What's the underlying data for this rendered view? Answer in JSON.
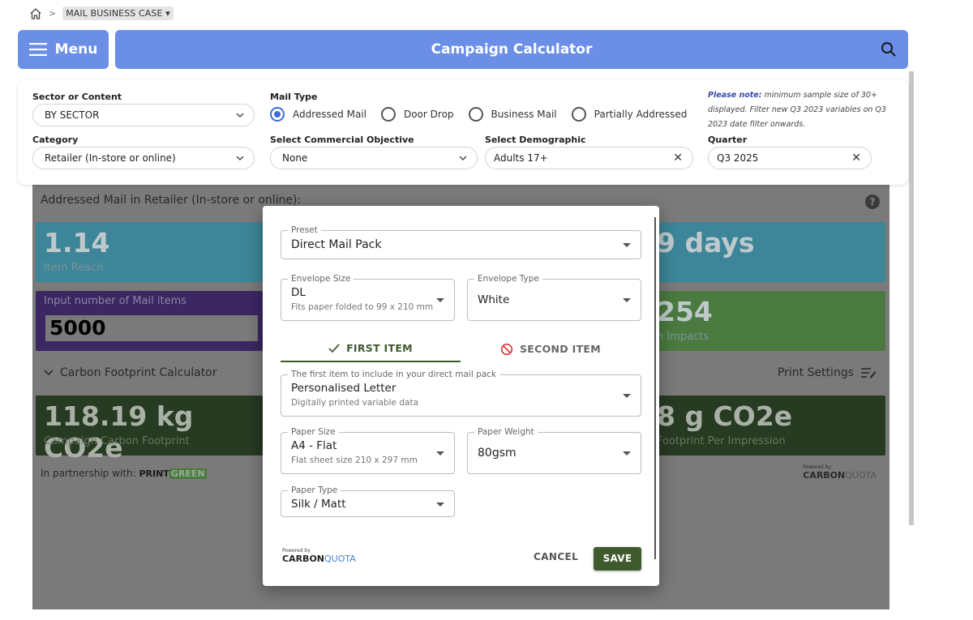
{
  "breadcrumb": {
    "current": "MAIL BUSINESS CASE"
  },
  "header": {
    "menu_label": "Menu",
    "title": "Campaign Calculator"
  },
  "filters": {
    "sector_label": "Sector or Content",
    "sector_value": "BY SECTOR",
    "category_label": "Category",
    "category_value": "Retailer (In-store or online)",
    "mail_type_label": "Mail Type",
    "mail_types": [
      "Addressed Mail",
      "Door Drop",
      "Business Mail",
      "Partially Addressed"
    ],
    "mail_type_selected": "Addressed Mail",
    "objective_label": "Select Commercial Objective",
    "objective_value": "None",
    "demographic_label": "Select Demographic",
    "demographic_value": "Adults 17+",
    "quarter_label": "Quarter",
    "quarter_value": "Q3 2025",
    "note_bold": "Please note:",
    "note_text": " minimum sample size of 30+ displayed. Filter new Q3 2023 variables on Q3 2023 date filter onwards."
  },
  "results": {
    "heading": "Addressed Mail in Retailer (In-store or online):",
    "reach_value": "1.14",
    "reach_label": "Item Reach",
    "days_value": "9 days",
    "input_label": "Input number of Mail items",
    "input_value": "5000",
    "impacts_value": "254",
    "impacts_label": "n Impacts",
    "carbon_toggle": "Carbon Footprint Calculator",
    "print_settings": "Print Settings",
    "carbon_value": "118.19 kg CO2e",
    "carbon_label": "Campaign Carbon Footprint",
    "carbon_per_value": "8 g CO2e",
    "carbon_per_label": "Footprint Per Impression",
    "partner_text": "In partnership with:",
    "partner_brand_a": "PRINT",
    "partner_brand_b": "GREEN",
    "powered_by": "Powered by",
    "cq_a": "CARBON",
    "cq_b": "QUOTA"
  },
  "dialog": {
    "preset_label": "Preset",
    "preset_value": "Direct Mail Pack",
    "envelope_size_label": "Envelope Size",
    "envelope_size_value": "DL",
    "envelope_size_sub": "Fits paper folded to 99 x 210 mm",
    "envelope_type_label": "Envelope Type",
    "envelope_type_value": "White",
    "tab_first": "FIRST ITEM",
    "tab_second": "SECOND ITEM",
    "first_item_label": "The first item to include in your direct mail pack",
    "first_item_value": "Personalised Letter",
    "first_item_sub": "Digitally printed variable data",
    "paper_size_label": "Paper Size",
    "paper_size_value": "A4 - Flat",
    "paper_size_sub": "Flat sheet size 210 x 297 mm",
    "paper_weight_label": "Paper Weight",
    "paper_weight_value": "80gsm",
    "paper_type_label": "Paper Type",
    "paper_type_value": "Silk / Matt",
    "powered_by": "Powered by",
    "cq_a": "CARBON",
    "cq_b": "QUOTA",
    "cancel": "CANCEL",
    "save": "SAVE"
  },
  "colors": {
    "accent_blue": "#6b8fe6",
    "save_green": "#3f5a2f",
    "radio_blue": "#3a6fd8"
  },
  "icons": [
    "home-icon",
    "menu-icon",
    "search-icon",
    "chevron-down-icon",
    "clear-icon",
    "help-icon",
    "check-icon",
    "block-icon",
    "print-settings-icon"
  ]
}
